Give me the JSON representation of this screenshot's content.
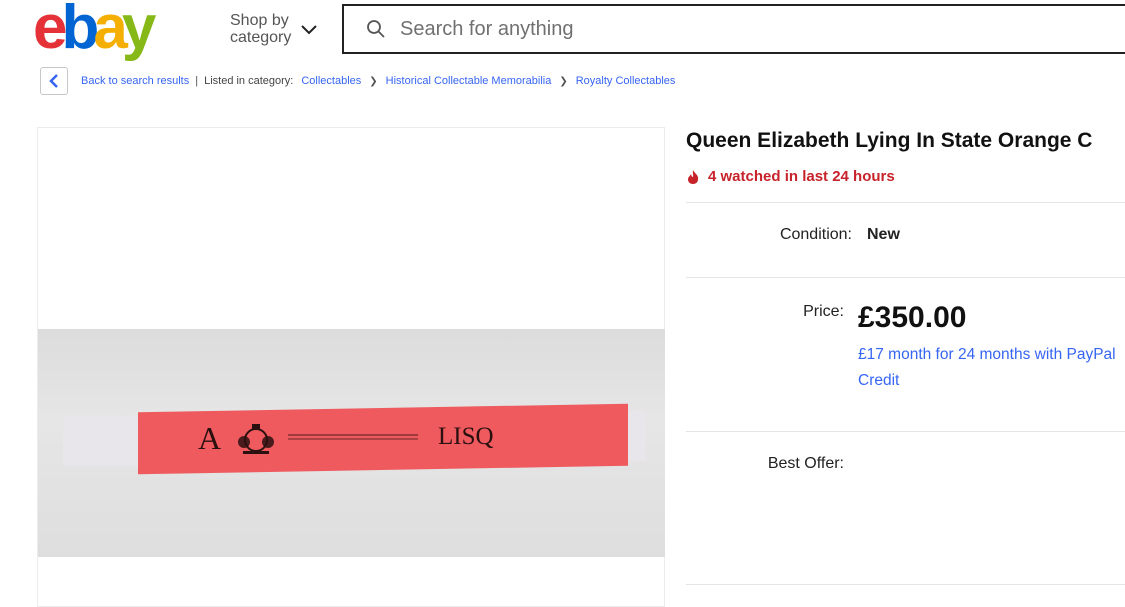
{
  "header": {
    "logo_letters": [
      "e",
      "b",
      "a",
      "y"
    ],
    "logo_colors": [
      "#e53238",
      "#0064d2",
      "#f5af02",
      "#86b817"
    ],
    "shop_by_line1": "Shop by",
    "shop_by_line2": "category",
    "search_placeholder": "Search for anything"
  },
  "breadcrumb": {
    "back_label": "Back to search results",
    "listed_label": "Listed in category:",
    "categories": [
      "Collectables",
      "Historical Collectable Memorabilia",
      "Royalty Collectables"
    ]
  },
  "gallery": {
    "band_letter": "A",
    "band_code": "LISQ"
  },
  "listing": {
    "title": "Queen Elizabeth Lying In State Orange C",
    "watch_text": "4 watched in last 24 hours",
    "condition_label": "Condition:",
    "condition_value": "New",
    "price_label": "Price:",
    "price_value": "£350.00",
    "credit_text": "£17 month for 24 months with PayPal Credit",
    "best_offer_label": "Best Offer:"
  },
  "colors": {
    "link": "#3665f3",
    "watch_red": "#c7232b",
    "wristband": "#ee5a5e"
  }
}
